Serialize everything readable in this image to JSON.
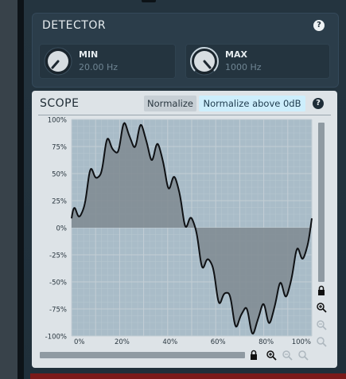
{
  "detector": {
    "title": "DETECTOR",
    "help": "?",
    "min": {
      "label": "MIN",
      "value": "20.00 Hz",
      "level": 0.0
    },
    "max": {
      "label": "MAX",
      "value": "1000 Hz",
      "level": 1.0
    }
  },
  "scope": {
    "title": "SCOPE",
    "help": "?",
    "normalize_label": "Normalize",
    "normalize_above_label": "Normalize above 0dB",
    "y_ticks": [
      "100%",
      "75%",
      "50%",
      "25%",
      "0%",
      "-25%",
      "-50%",
      "-75%",
      "-100%"
    ],
    "x_ticks": [
      "0%",
      "20%",
      "40%",
      "60%",
      "80%",
      "100%"
    ],
    "colors": {
      "fill": "#7f8a91",
      "line": "#0f1114",
      "grid": "#c3ced5",
      "active_button": "#cdeefc"
    }
  },
  "icons": {
    "lock": "lock-icon",
    "zoom_in": "zoom-in-icon",
    "zoom_out": "zoom-out-icon",
    "zoom_reset": "zoom-reset-icon"
  }
}
